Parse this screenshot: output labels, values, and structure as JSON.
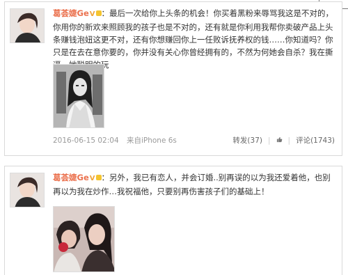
{
  "post1": {
    "username": "葛荟婕Ge",
    "badge": "V",
    "text": "：最后一次给你上头条的机会！你买着黑粉来辱骂我这是不对的，你用你的新欢来照顾我的孩子也是不对的，还有就是你利用我帮你卖破产品上头条赚钱泡妞这更不对，还有你想赚回你上一任败诉抚养权的钱……你知道吗？你只是在去在意你要的，你并没有关心你曾经拥有的，不然为何她会自杀？我在撕逼，她聪明的玩",
    "timestamp": "2016-06-15 02:04",
    "source": "来自iPhone 6s",
    "repost": "转发(37)",
    "comment": "评论(1743)"
  },
  "post2": {
    "username": "葛荟婕Ge",
    "badge": "V",
    "text": "：另外，我已有恋人，并会订婚..别再误的以为我还爱着他，也别再以为我在炒作…我祝福他，只要别再伤害孩子们的基础上！"
  },
  "colors": {
    "username": "#eb7350",
    "meta": "#9a9a9a",
    "border": "#d9d9d9"
  }
}
